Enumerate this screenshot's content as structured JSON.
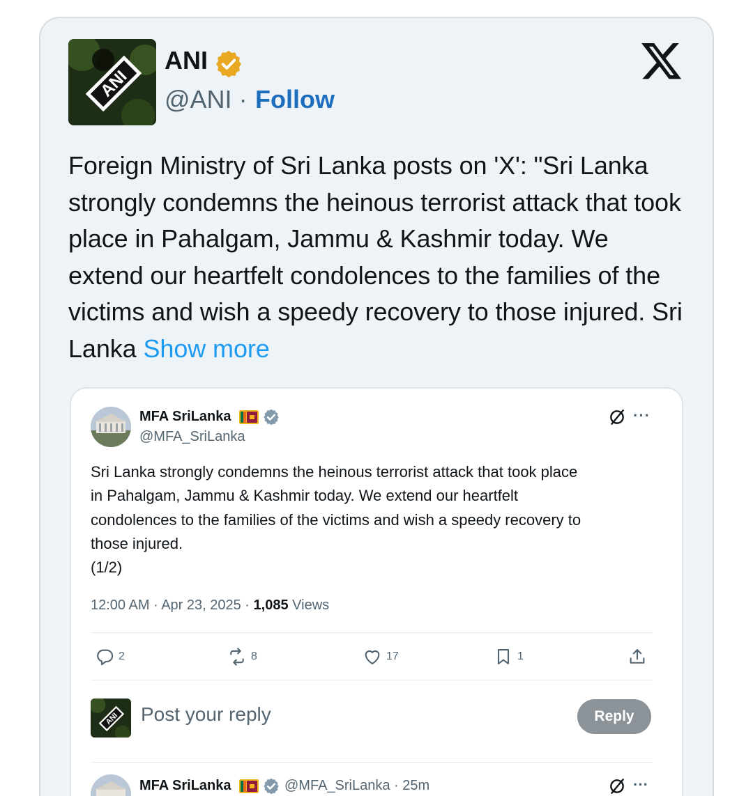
{
  "post": {
    "author_name": "ANI",
    "handle": "@ANI",
    "separator": "·",
    "follow_label": "Follow",
    "avatar_text": "ANI",
    "text": "Foreign Ministry of Sri Lanka posts on 'X': \"Sri Lanka strongly condemns the heinous terrorist attack that took place in Pahalgam, Jammu & Kashmir today. We extend our heartfelt condolences to the families of the victims and wish a speedy recovery to those injured. Sri Lanka ",
    "show_more": "Show more"
  },
  "embedded": {
    "author_name": "MFA SriLanka",
    "handle": "@MFA_SriLanka",
    "more": "···",
    "text_lines": [
      "Sri Lanka strongly condemns the heinous terrorist attack that took place",
      "in Pahalgam, Jammu & Kashmir today. We extend our heartfelt",
      "condolences to the families of the victims and wish a speedy recovery to",
      "those injured.",
      "(1/2)"
    ],
    "time": "12:00 AM",
    "date": "Apr 23, 2025",
    "views_count": "1,085",
    "views_label": "Views",
    "dot": "·",
    "actions": {
      "replies": "2",
      "reposts": "8",
      "likes": "17",
      "bookmarks": "1"
    },
    "reply_placeholder": "Post your reply",
    "reply_button": "Reply"
  },
  "second_reply": {
    "author_name": "MFA SriLanka",
    "handle_time": "@MFA_SriLanka · 25m",
    "more": "···"
  },
  "colors": {
    "card_bg": "#eef3f7",
    "link": "#1d6fbe",
    "show_more": "#1d9bf0",
    "verified_gold": "#e8a820",
    "verified_gray": "#829aab",
    "reply_button_bg": "#8b9298"
  },
  "icons": [
    "verified-gold-icon",
    "x-logo-icon",
    "verified-gray-icon",
    "sri-lanka-flag-icon",
    "grok-icon",
    "more-icon",
    "reply-icon",
    "repost-icon",
    "like-icon",
    "bookmark-icon",
    "share-icon"
  ]
}
